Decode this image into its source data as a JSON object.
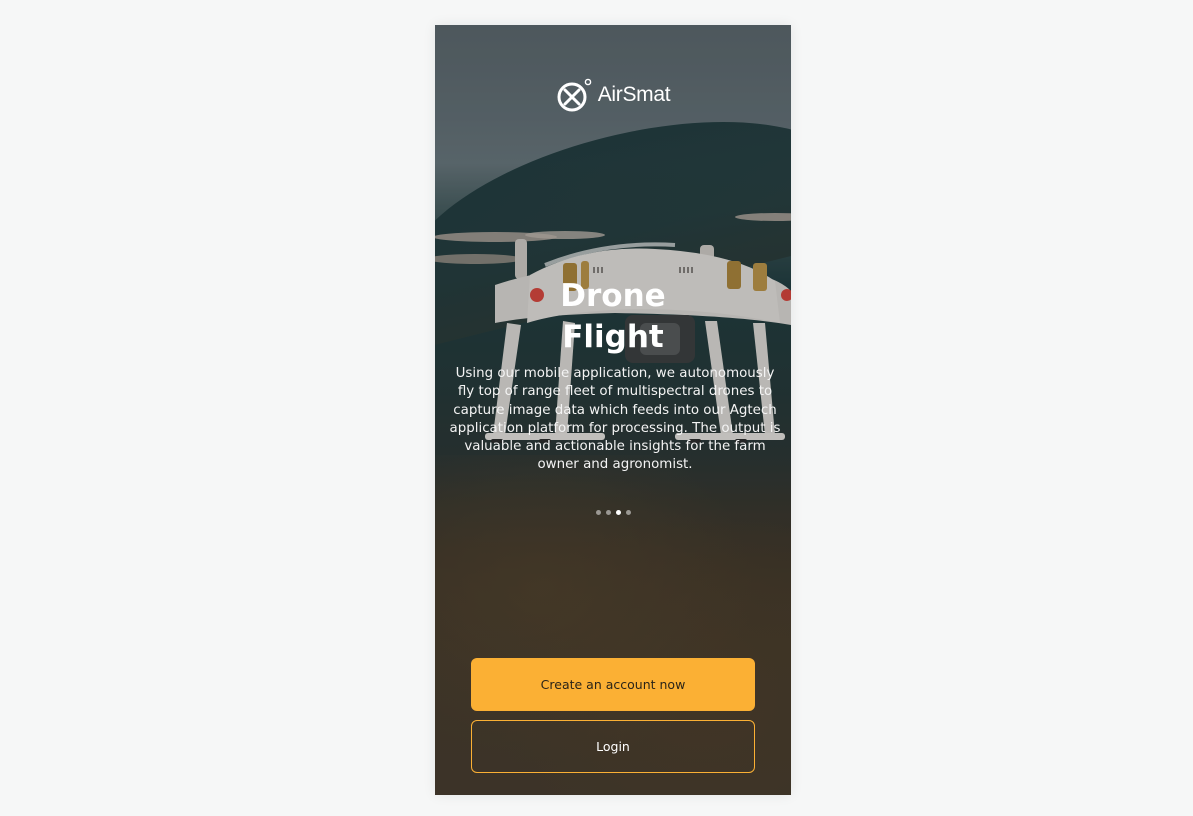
{
  "brand": {
    "name": "AirSmat",
    "logo_icon": "airsmat-logo-icon",
    "accent_color": "#fbb034"
  },
  "slide": {
    "title_line1": "Drone",
    "title_line2": "Flight",
    "description": "Using our mobile application, we autonomously fly top of range fleet of multispectral drones to capture image data which feeds into our Agtech application platform for processing. The output is valuable and actionable insights for the farm owner and agronomist.",
    "pagination": {
      "total": 4,
      "active_index": 3
    }
  },
  "actions": {
    "create_account_label": "Create an account now",
    "login_label": "Login"
  }
}
